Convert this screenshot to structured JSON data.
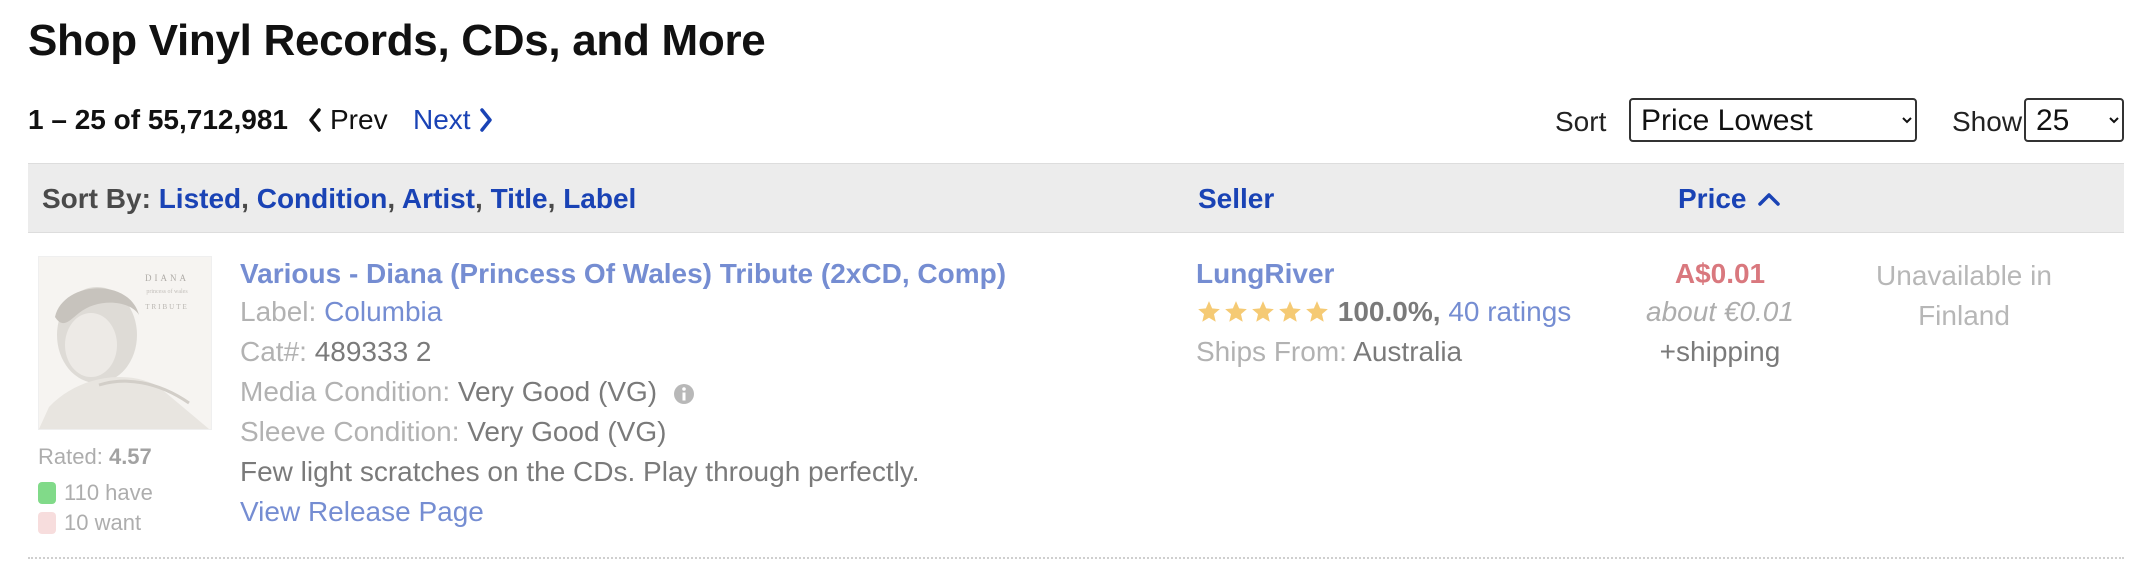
{
  "page_title": "Shop Vinyl Records, CDs, and More",
  "pagination": {
    "range": "1 – 25 of 55,712,981",
    "prev": "Prev",
    "next": "Next"
  },
  "sort": {
    "label": "Sort",
    "selected": "Price Lowest",
    "show_label": "Show",
    "show_selected": "25"
  },
  "sortbar": {
    "label": "Sort By:",
    "fields": [
      "Listed",
      "Condition",
      "Artist",
      "Title",
      "Label"
    ],
    "seller_header": "Seller",
    "price_header": "Price"
  },
  "listing": {
    "thumb_lines": [
      "DIANA",
      "princess of wales",
      "TRIBUTE"
    ],
    "rated_label": "Rated:",
    "rating": "4.57",
    "have": "110 have",
    "want": "10 want",
    "title": "Various - Diana (Princess Of Wales) Tribute (2xCD, Comp)",
    "label_key": "Label:",
    "label_value": "Columbia",
    "cat_key": "Cat#:",
    "cat_value": "489333 2",
    "media_key": "Media Condition:",
    "media_value": "Very Good (VG)",
    "sleeve_key": "Sleeve Condition:",
    "sleeve_value": "Very Good (VG)",
    "comment": "Few light scratches on the CDs. Play through perfectly.",
    "view_link": "View Release Page",
    "seller": "LungRiver",
    "seller_rating": "100.0%,",
    "seller_ratings_count": "40 ratings",
    "ships_from_key": "Ships From:",
    "ships_from_value": "Australia",
    "price": "A$0.01",
    "price_converted": "about €0.01",
    "shipping": "+shipping",
    "availability": "Unavailable in Finland",
    "stars": 5
  },
  "colors": {
    "link": "#1a43b5",
    "price": "#c0202a",
    "have": "#2fc23c",
    "want": "#f2c8c8",
    "star": "#f0a818"
  }
}
